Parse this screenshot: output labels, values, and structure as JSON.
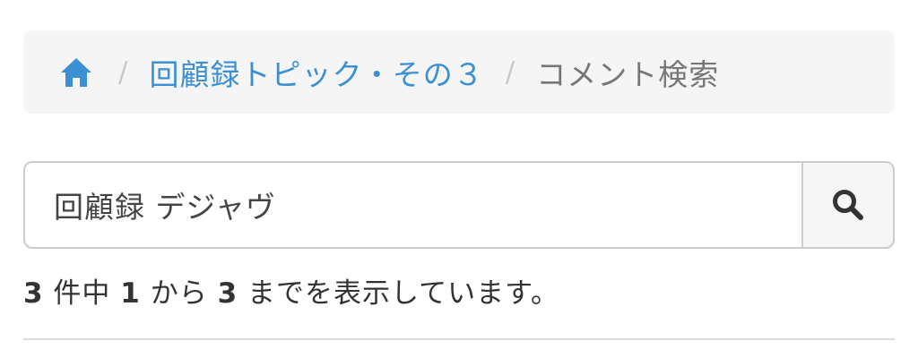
{
  "breadcrumb": {
    "home_icon": "home-icon",
    "separator": "/",
    "topic": "回顧録トピック・その３",
    "current": "コメント検索"
  },
  "search": {
    "value": "回顧録 デジャヴ",
    "button_icon": "search-icon"
  },
  "results": {
    "total": "3",
    "text_total_suffix": " 件中 ",
    "from": "1",
    "text_from_suffix": " から ",
    "to": "3",
    "text_to_suffix": " までを表示しています。"
  },
  "colors": {
    "link": "#3b8fd3",
    "breadcrumb_bg": "#f5f5f5",
    "muted": "#777777"
  }
}
